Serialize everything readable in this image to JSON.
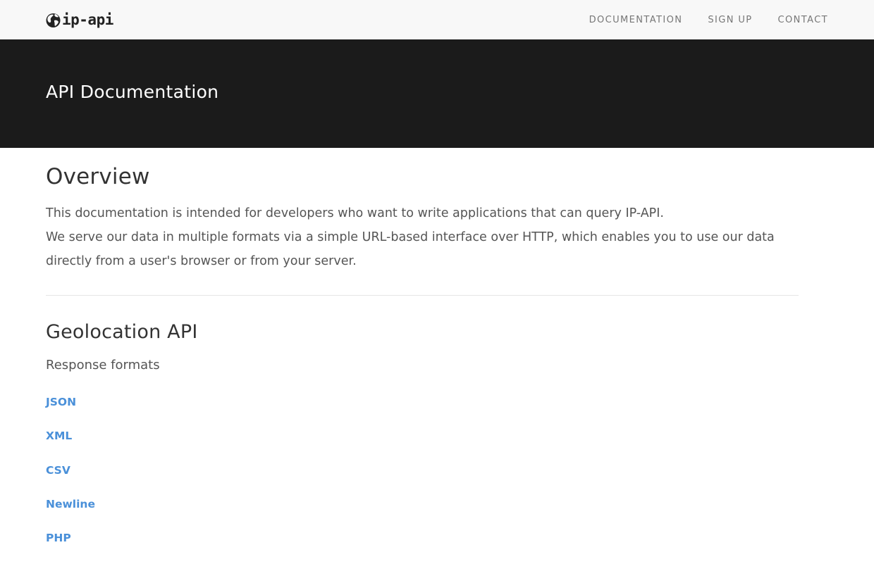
{
  "header": {
    "logo_text": "ip-api",
    "logo_icon": "globe-icon",
    "nav": [
      {
        "label": "DOCUMENTATION"
      },
      {
        "label": "SIGN UP"
      },
      {
        "label": "CONTACT"
      }
    ]
  },
  "hero": {
    "title": "API Documentation"
  },
  "overview": {
    "heading": "Overview",
    "line1": "This documentation is intended for developers who want to write applications that can query IP-API.",
    "line2": "We serve our data in multiple formats via a simple URL-based interface over HTTP, which enables you to use our data directly from a user's browser or from your server."
  },
  "geolocation": {
    "heading": "Geolocation API",
    "formats_label": "Response formats",
    "formats": [
      {
        "label": "JSON"
      },
      {
        "label": "XML"
      },
      {
        "label": "CSV"
      },
      {
        "label": "Newline"
      },
      {
        "label": "PHP"
      }
    ]
  },
  "colors": {
    "hero_bg": "#1b1b1b",
    "navbar_bg": "#f8f8f8",
    "link": "#4a90d9"
  }
}
